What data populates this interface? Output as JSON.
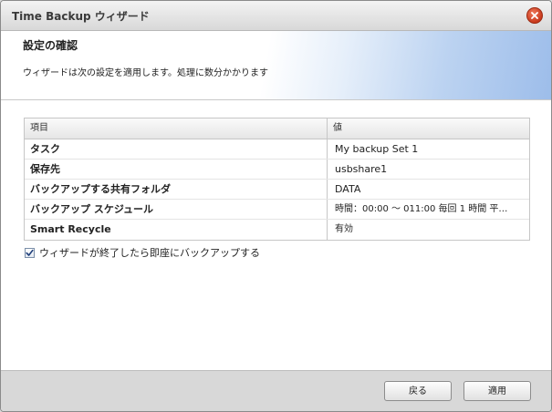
{
  "window": {
    "title": "Time Backup ウィザード"
  },
  "header": {
    "title": "設定の確認",
    "description": "ウィザードは次の設定を適用します。処理に数分かかります"
  },
  "table": {
    "columns": [
      "項目",
      "値"
    ],
    "rows": [
      {
        "key": "タスク",
        "value": "My backup Set 1"
      },
      {
        "key": "保存先",
        "value": "usbshare1"
      },
      {
        "key": "バックアップする共有フォルダ",
        "value": "DATA"
      },
      {
        "key": "バックアップ スケジュール",
        "value": "時間：00:00 ～ 011:00 毎回 1 時間 平…"
      },
      {
        "key": "Smart Recycle",
        "value": "有効"
      }
    ]
  },
  "options": {
    "backup_now_label": "ウィザードが終了したら即座にバックアップする",
    "backup_now_checked": true
  },
  "footer": {
    "back_label": "戻る",
    "apply_label": "適用"
  },
  "colors": {
    "close_button": "#d9482a",
    "header_gradient_end": "#9dbdea",
    "footer_bg": "#d8d8d8"
  },
  "icons": {
    "close": "close-icon",
    "check": "checkmark-icon"
  }
}
